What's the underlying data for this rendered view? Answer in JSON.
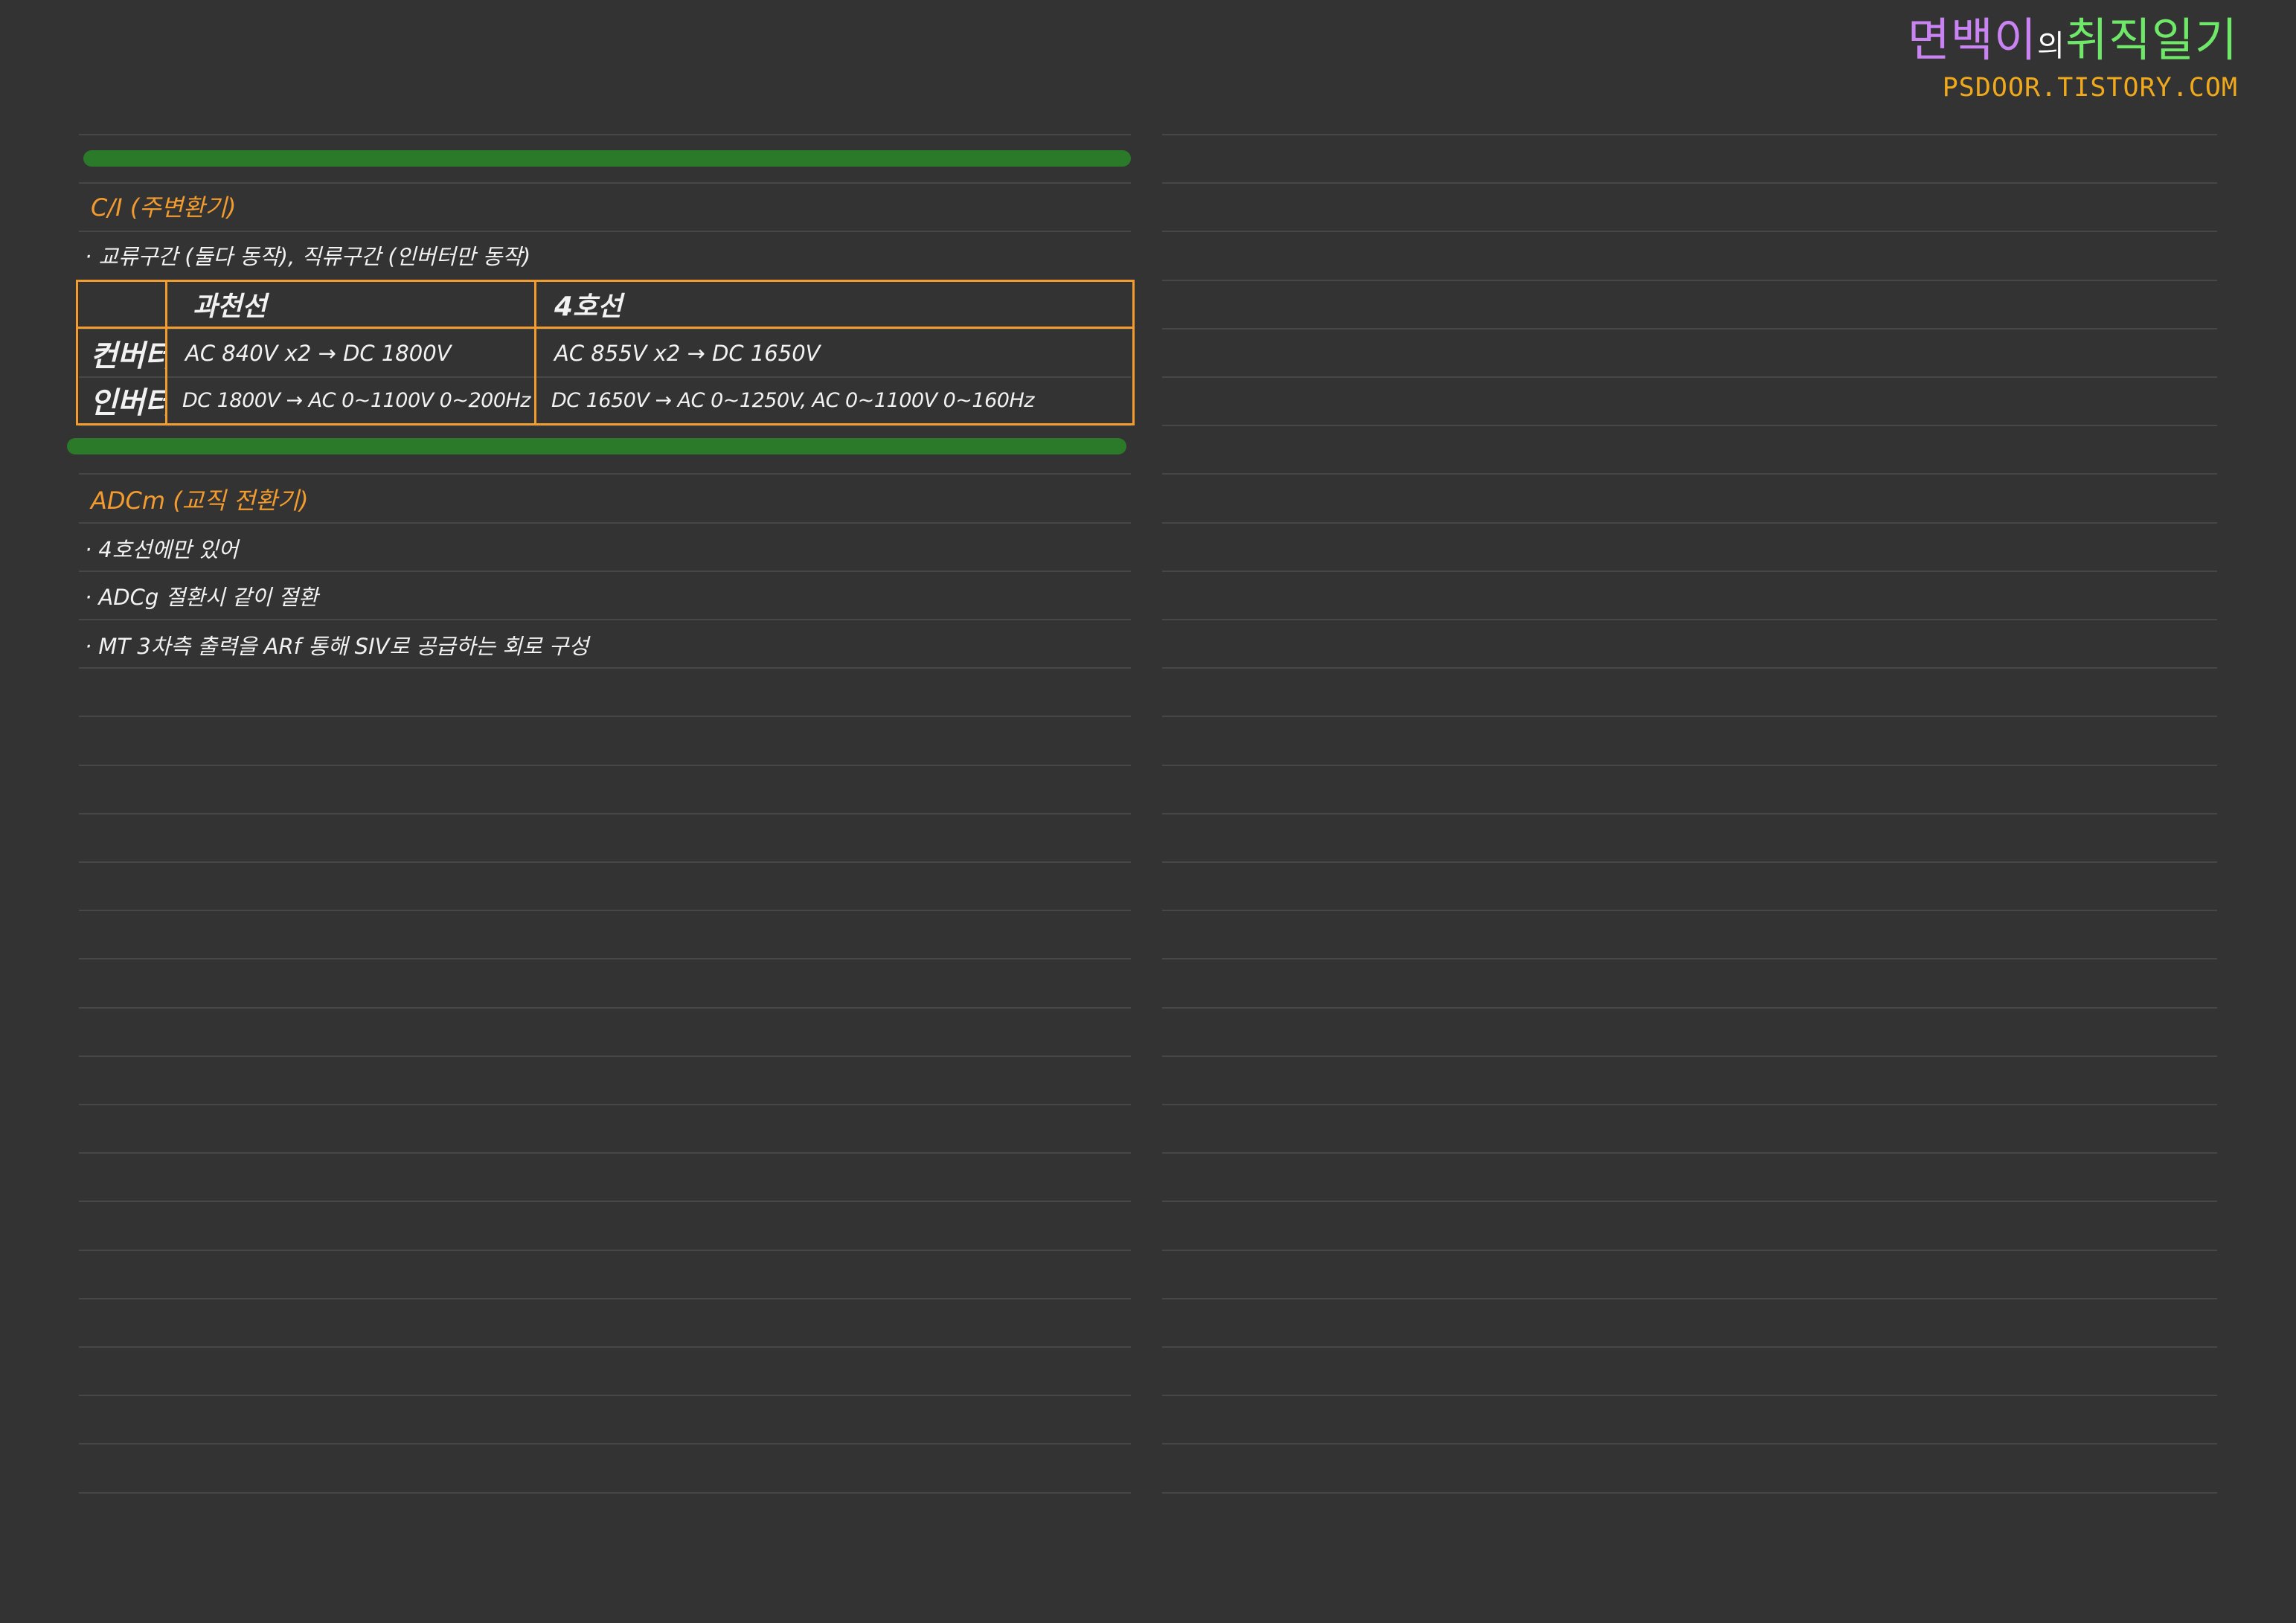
{
  "brand": {
    "title_part1": "면백이",
    "title_part2": "의",
    "title_part3": "취직일기",
    "url": "PSDOOR.TISTORY.COM",
    "colors": {
      "part1": "#c983f2",
      "part3": "#6fe86a",
      "url": "#f0a91c"
    }
  },
  "section1": {
    "heading": "C/I (주변환기)",
    "line1": "· 교류구간 (둘다 동작),  직류구간 (인버터만 동작)",
    "table": {
      "columns": [
        "",
        "과천선",
        "4호선"
      ],
      "rows": [
        {
          "label": "컨버터",
          "c1": "AC 840V x2 → DC 1800V",
          "c2": "AC 855V x2 → DC 1650V"
        },
        {
          "label": "인버터",
          "c1": "DC 1800V → AC 0~1100V  0~200Hz",
          "c2": "DC 1650V → AC 0~1250V, AC 0~1100V  0~160Hz"
        }
      ]
    }
  },
  "section2": {
    "heading": "ADCm (교직 전환기)",
    "lines": [
      "· 4호선에만 있어",
      "· ADCg 절환시 같이 절환",
      "· MT 3차측 출력을 ARf 통해 SIV로 공급하는 회로 구성"
    ]
  },
  "colors": {
    "background": "#333333",
    "accent_orange": "#f29b2e",
    "divider_green": "#2a7a2a"
  }
}
